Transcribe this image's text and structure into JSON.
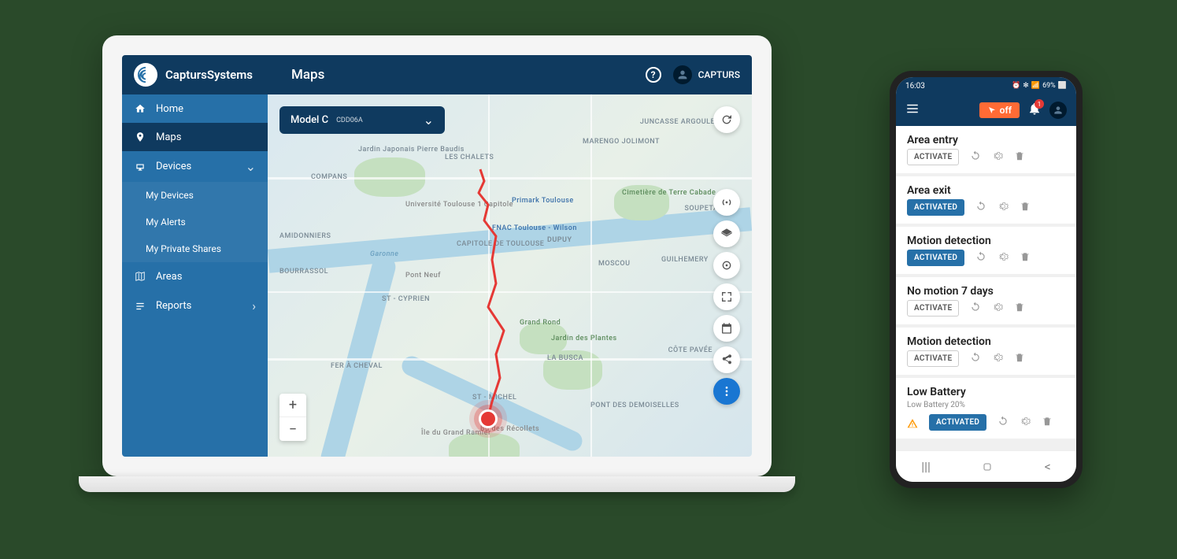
{
  "brand": "CaptursSystems",
  "pageTitle": "Maps",
  "user": {
    "name": "CAPTURS"
  },
  "sidebar": {
    "items": [
      {
        "label": "Home",
        "icon": "home"
      },
      {
        "label": "Maps",
        "icon": "map-pin",
        "active": true
      },
      {
        "label": "Devices",
        "icon": "devices",
        "expandable": true
      },
      {
        "label": "Areas",
        "icon": "areas"
      },
      {
        "label": "Reports",
        "icon": "reports",
        "expandable": true
      }
    ],
    "devicesSub": [
      {
        "label": "My Devices"
      },
      {
        "label": "My Alerts"
      },
      {
        "label": "My Private Shares"
      }
    ]
  },
  "deviceSelector": {
    "model": "Model C",
    "code": "CDD06A"
  },
  "mapLabels": {
    "juncasse": "JUNCASSE\nARGOULETS",
    "marengo": "MARENGO\nJOLIMONT",
    "chalets": "LES CHALETS",
    "compans": "COMPANS",
    "amidonniers": "AMIDONNIERS",
    "bourrassol": "BOURRASSOL",
    "capitole": "CAPITOLE DE\nTOULOUSE",
    "dupuy": "DUPUY",
    "moscou": "MOSCOU",
    "guilhemery": "GUILHEMERY",
    "soupetard": "SOUPETARD",
    "stcyprien": "ST - CYPRIEN",
    "feracheval": "FER À CHEVAL",
    "labusca": "LA BUSCA",
    "cotepavee": "CÔTE PAVÉE",
    "stmichel": "ST - MICHEL",
    "pontdes": "PONT DES\nDEMOISELLES",
    "terrecabade": "Cimetière de\nTerre Cabade",
    "jardin": "Jardin Japonais\nPierre Baudis",
    "primark": "Primark Toulouse",
    "universite": "Université\nToulouse\n1 Capitole",
    "fnac": "FNAC Toulouse - Wilson",
    "grandrond": "Grand Rond",
    "jardindesplantes": "Jardin des\nPlantes",
    "pontneuf": "Pont Neuf",
    "garonne": "Garonne",
    "iledugrand": "Île du Grand\nRamier",
    "recollets": "Bd des Récollets"
  },
  "phone": {
    "time": "16:03",
    "battery": "69%",
    "offLabel": "off",
    "notifCount": "1",
    "alerts": [
      {
        "title": "Area entry",
        "activated": false,
        "btnLabel": "ACTIVATE"
      },
      {
        "title": "Area exit",
        "activated": true,
        "btnLabel": "ACTIVATED"
      },
      {
        "title": "Motion detection",
        "activated": true,
        "btnLabel": "ACTIVATED"
      },
      {
        "title": "No motion 7 days",
        "activated": false,
        "btnLabel": "ACTIVATE"
      },
      {
        "title": "Motion detection",
        "activated": false,
        "btnLabel": "ACTIVATE"
      },
      {
        "title": "Low Battery",
        "subtitle": "Low Battery 20%",
        "activated": true,
        "btnLabel": "ACTIVATED",
        "warn": true
      }
    ]
  }
}
